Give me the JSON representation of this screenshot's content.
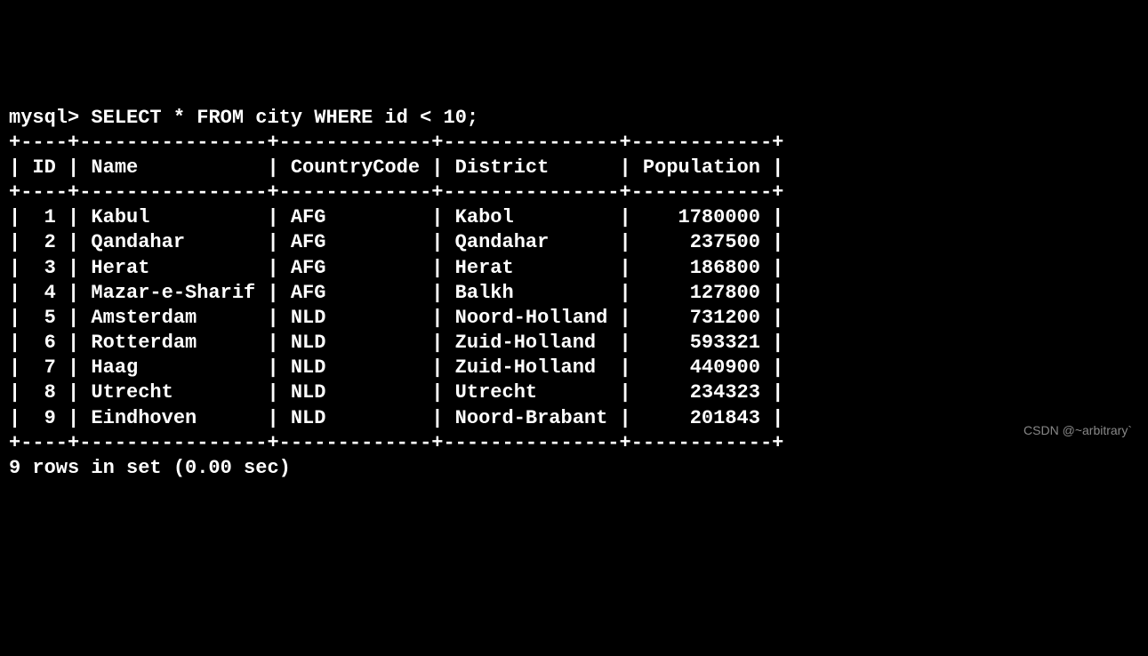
{
  "terminal": {
    "prompt": "mysql> ",
    "query": "SELECT * FROM city WHERE id < 10;",
    "border_top": "+----+----------------+-------------+---------------+------------+",
    "border_mid": "+----+----------------+-------------+---------------+------------+",
    "border_bottom": "+----+----------------+-------------+---------------+------------+",
    "header_line": "| ID | Name           | CountryCode | District      | Population |",
    "row_lines": [
      "|  1 | Kabul          | AFG         | Kabol         |    1780000 |",
      "|  2 | Qandahar       | AFG         | Qandahar      |     237500 |",
      "|  3 | Herat          | AFG         | Herat         |     186800 |",
      "|  4 | Mazar-e-Sharif | AFG         | Balkh         |     127800 |",
      "|  5 | Amsterdam      | NLD         | Noord-Holland |     731200 |",
      "|  6 | Rotterdam      | NLD         | Zuid-Holland  |     593321 |",
      "|  7 | Haag           | NLD         | Zuid-Holland  |     440900 |",
      "|  8 | Utrecht        | NLD         | Utrecht       |     234323 |",
      "|  9 | Eindhoven      | NLD         | Noord-Brabant |     201843 |"
    ],
    "footer": "9 rows in set (0.00 sec)"
  },
  "chart_data": {
    "type": "table",
    "columns": [
      "ID",
      "Name",
      "CountryCode",
      "District",
      "Population"
    ],
    "rows": [
      [
        1,
        "Kabul",
        "AFG",
        "Kabol",
        1780000
      ],
      [
        2,
        "Qandahar",
        "AFG",
        "Qandahar",
        237500
      ],
      [
        3,
        "Herat",
        "AFG",
        "Herat",
        186800
      ],
      [
        4,
        "Mazar-e-Sharif",
        "AFG",
        "Balkh",
        127800
      ],
      [
        5,
        "Amsterdam",
        "NLD",
        "Noord-Holland",
        731200
      ],
      [
        6,
        "Rotterdam",
        "NLD",
        "Zuid-Holland",
        593321
      ],
      [
        7,
        "Haag",
        "NLD",
        "Zuid-Holland",
        440900
      ],
      [
        8,
        "Utrecht",
        "NLD",
        "Utrecht",
        234323
      ],
      [
        9,
        "Eindhoven",
        "NLD",
        "Noord-Brabant",
        201843
      ]
    ]
  },
  "watermark": "CSDN @~arbitrary`"
}
